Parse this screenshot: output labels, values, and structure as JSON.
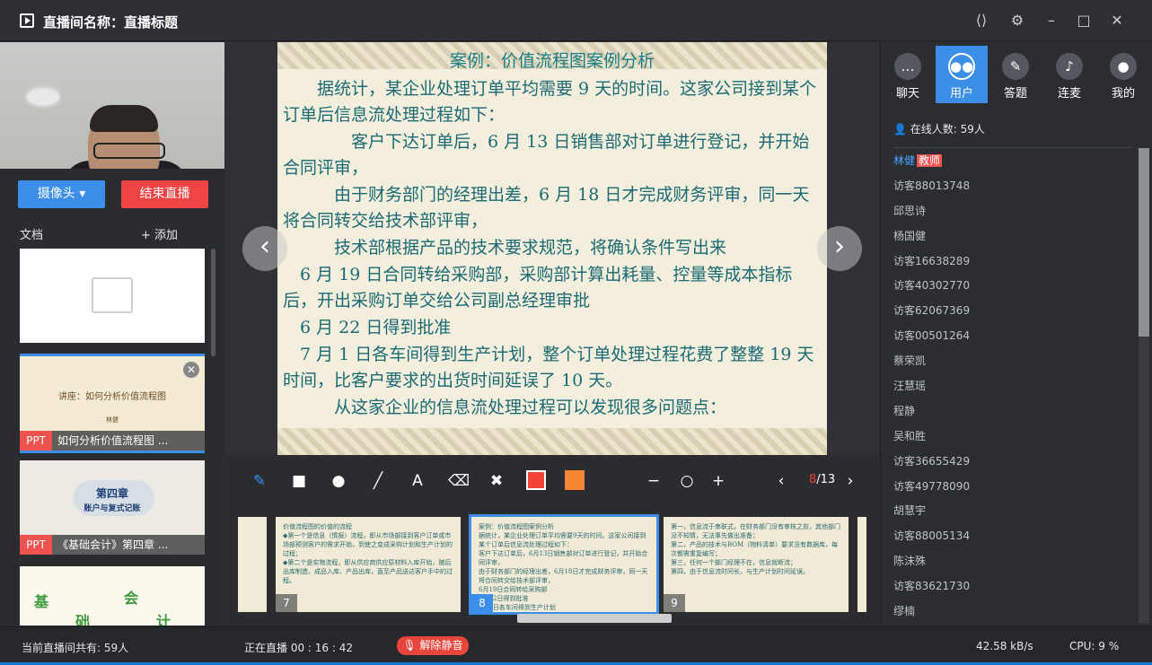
{
  "window": {
    "title": "直播间名称：直播标题"
  },
  "left": {
    "camera_btn": "摄像头 ▾",
    "end_btn": "结束直播",
    "doc_label": "文档",
    "add_label": "+ 添加",
    "docs": [
      {
        "type": "",
        "name": ""
      },
      {
        "type": "PPT",
        "name": "如何分析价值流程图 ...",
        "preview_title": "讲座：如何分析价值流程图",
        "preview_author": "林健"
      },
      {
        "type": "PPT",
        "name": "《基础会计》第四章 ...",
        "preview_title": "第四章",
        "preview_sub": "账户与复式记账"
      },
      {
        "type": "",
        "name": "",
        "preview_chars": [
          "基",
          "础",
          "会",
          "计"
        ]
      }
    ]
  },
  "slide": {
    "title": "案例：价值流程图案例分析",
    "lines": [
      "　　据统计，某企业处理订单平均需要 9 天的时间。这家公司接到某个订单后信息流处理过程如下：",
      "　　　　客户下达订单后，6 月 13 日销售部对订单进行登记，并开始合同评审，",
      "　　　由于财务部门的经理出差，6 月 18 日才完成财务评审，同一天将合同转交给技术部评审，",
      "　　　技术部根据产品的技术要求规范，将确认条件写出来",
      "　6 月 19 日合同转给采购部，采购部计算出耗量、控量等成本指标后，开出采购订单交给公司副总经理审批",
      "　6 月 22 日得到批准",
      "　7 月 1 日各车间得到生产计划，整个订单处理过程花费了整整 19 天时间，比客户要求的出货时间延误了 10 天。",
      "　　　从这家企业的信息流处理过程可以发现很多问题点："
    ]
  },
  "toolbar": {
    "colors": {
      "red": "#f04438",
      "orange": "#f58634"
    },
    "page_current": "8",
    "page_total": "/13"
  },
  "thumbs": [
    {
      "num": "",
      "lines": []
    },
    {
      "num": "7",
      "lines": [
        "价值流程图的价值的流程",
        "◆第一个是信息（情报）流程，即从市场部接到客户订单或市场部预测客户的需求开始，到使之变成采购计划和生产计划的过程；",
        "◆第二个是实物流程，即从供应商供应原材料入库开始，随后出库制造、成品入库、产品出库，直至产品送达客户手中的过程。"
      ]
    },
    {
      "num": "8",
      "lines": [
        "案例：价值流程图案例分析",
        "据统计，某企业处理订单平均需要9天的时间。这家公司接到某个订单后信息流处理过程如下：",
        "客户下达订单后，6月13日销售部对订单进行登记，并开始合同评审，",
        "由于财务部门的经理出差，6月18日才完成财务评审，同一天将合同转交给技术部评审，",
        "6月19日合同转给采购部",
        "6月22日得到批准",
        "7月1日各车间得到生产计划"
      ]
    },
    {
      "num": "9",
      "lines": [
        "第一，信息流于串联式，在财务部门没有审核之前，其他部门没不知情，无法事先做出准备；",
        "第二，产品的技术与BOM（物料清单）要求没有数据库，每次都需重复编写；",
        "第三，任何一个部门经理不在，信息就断流；",
        "第四，由于信息流时间长，与生产计划时间延误。"
      ]
    }
  ],
  "right": {
    "tabs": [
      {
        "label": "聊天",
        "icon": "chat-icon"
      },
      {
        "label": "用户",
        "icon": "users-icon"
      },
      {
        "label": "答题",
        "icon": "pen-icon"
      },
      {
        "label": "连麦",
        "icon": "mic-icon"
      },
      {
        "label": "我的",
        "icon": "person-icon"
      }
    ],
    "online": "在线人数: 59人",
    "teacher_badge": "教师",
    "users": [
      "林健",
      "访客88013748",
      "邱思诗",
      "杨国健",
      "访客16638289",
      "访客40302770",
      "访客62067369",
      "访客00501264",
      "蔡荣凯",
      "汪慧瑶",
      "程静",
      "吴和胜",
      "访客36655429",
      "访客49778090",
      "胡慧宇",
      "访客88005134",
      "陈沫殊",
      "访客83621730",
      "缪楠"
    ]
  },
  "status": {
    "total": "当前直播间共有: 59人",
    "live": "正在直播 00 : 16 : 42",
    "mute": "解除静音",
    "speed": "42.58 kB/s",
    "cpu": "CPU:  9 %"
  }
}
